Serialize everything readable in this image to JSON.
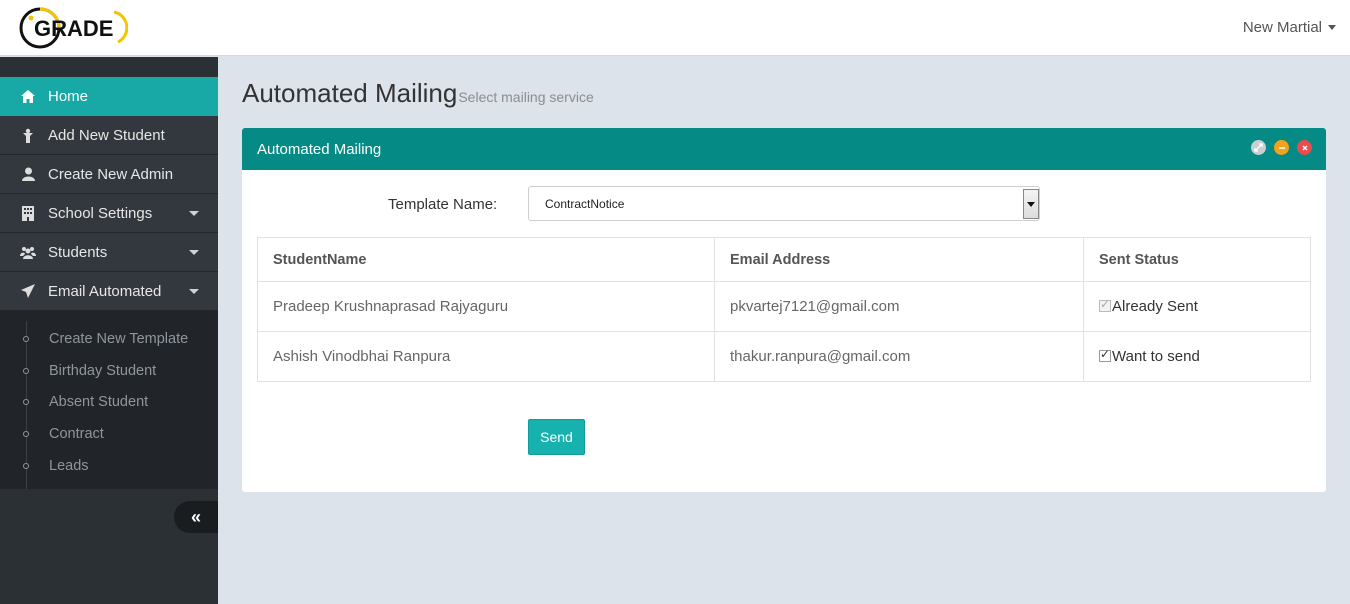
{
  "header": {
    "logo_text": "GRADE",
    "user_name": "New Martial"
  },
  "sidebar": {
    "items": [
      {
        "label": "Home",
        "icon": "home-icon",
        "active": true
      },
      {
        "label": "Add New Student",
        "icon": "person-add-icon"
      },
      {
        "label": "Create New Admin",
        "icon": "user-icon"
      },
      {
        "label": "School Settings",
        "icon": "building-icon"
      },
      {
        "label": "Students",
        "icon": "users-icon"
      },
      {
        "label": "Email Automated",
        "icon": "paper-plane-icon"
      }
    ],
    "subitems": [
      "Create New Template",
      "Birthday Student",
      "Absent Student",
      "Contract",
      "Leads"
    ],
    "collapse_symbol": "«"
  },
  "page": {
    "title": "Automated Mailing",
    "subtitle": "Select mailing service"
  },
  "panel": {
    "title": "Automated Mailing",
    "template_label": "Template Name:",
    "template_value": "ContractNotice",
    "columns": [
      "StudentName",
      "Email Address",
      "Sent Status"
    ],
    "rows": [
      {
        "name": "Pradeep Krushnaprasad Rajyaguru",
        "email": "pkvartej7121@gmail.com",
        "status": "Already Sent",
        "checked": true,
        "disabled": true
      },
      {
        "name": "Ashish Vinodbhai Ranpura",
        "email": "thakur.ranpura@gmail.com",
        "status": "Want to send",
        "checked": true,
        "disabled": false
      }
    ],
    "send_label": "Send"
  },
  "colors": {
    "accent": "#18a8a6",
    "panel_header": "#058a86",
    "sidebar": "#2b3035"
  }
}
